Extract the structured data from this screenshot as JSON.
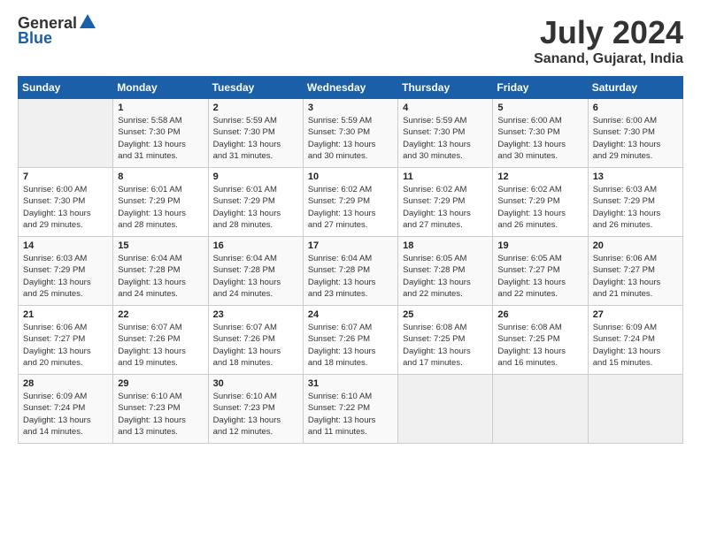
{
  "header": {
    "logo_general": "General",
    "logo_blue": "Blue",
    "title": "July 2024",
    "location": "Sanand, Gujarat, India"
  },
  "days_of_week": [
    "Sunday",
    "Monday",
    "Tuesday",
    "Wednesday",
    "Thursday",
    "Friday",
    "Saturday"
  ],
  "weeks": [
    [
      {
        "day": "",
        "info": ""
      },
      {
        "day": "1",
        "info": "Sunrise: 5:58 AM\nSunset: 7:30 PM\nDaylight: 13 hours\nand 31 minutes."
      },
      {
        "day": "2",
        "info": "Sunrise: 5:59 AM\nSunset: 7:30 PM\nDaylight: 13 hours\nand 31 minutes."
      },
      {
        "day": "3",
        "info": "Sunrise: 5:59 AM\nSunset: 7:30 PM\nDaylight: 13 hours\nand 30 minutes."
      },
      {
        "day": "4",
        "info": "Sunrise: 5:59 AM\nSunset: 7:30 PM\nDaylight: 13 hours\nand 30 minutes."
      },
      {
        "day": "5",
        "info": "Sunrise: 6:00 AM\nSunset: 7:30 PM\nDaylight: 13 hours\nand 30 minutes."
      },
      {
        "day": "6",
        "info": "Sunrise: 6:00 AM\nSunset: 7:30 PM\nDaylight: 13 hours\nand 29 minutes."
      }
    ],
    [
      {
        "day": "7",
        "info": "Sunrise: 6:00 AM\nSunset: 7:30 PM\nDaylight: 13 hours\nand 29 minutes."
      },
      {
        "day": "8",
        "info": "Sunrise: 6:01 AM\nSunset: 7:29 PM\nDaylight: 13 hours\nand 28 minutes."
      },
      {
        "day": "9",
        "info": "Sunrise: 6:01 AM\nSunset: 7:29 PM\nDaylight: 13 hours\nand 28 minutes."
      },
      {
        "day": "10",
        "info": "Sunrise: 6:02 AM\nSunset: 7:29 PM\nDaylight: 13 hours\nand 27 minutes."
      },
      {
        "day": "11",
        "info": "Sunrise: 6:02 AM\nSunset: 7:29 PM\nDaylight: 13 hours\nand 27 minutes."
      },
      {
        "day": "12",
        "info": "Sunrise: 6:02 AM\nSunset: 7:29 PM\nDaylight: 13 hours\nand 26 minutes."
      },
      {
        "day": "13",
        "info": "Sunrise: 6:03 AM\nSunset: 7:29 PM\nDaylight: 13 hours\nand 26 minutes."
      }
    ],
    [
      {
        "day": "14",
        "info": "Sunrise: 6:03 AM\nSunset: 7:29 PM\nDaylight: 13 hours\nand 25 minutes."
      },
      {
        "day": "15",
        "info": "Sunrise: 6:04 AM\nSunset: 7:28 PM\nDaylight: 13 hours\nand 24 minutes."
      },
      {
        "day": "16",
        "info": "Sunrise: 6:04 AM\nSunset: 7:28 PM\nDaylight: 13 hours\nand 24 minutes."
      },
      {
        "day": "17",
        "info": "Sunrise: 6:04 AM\nSunset: 7:28 PM\nDaylight: 13 hours\nand 23 minutes."
      },
      {
        "day": "18",
        "info": "Sunrise: 6:05 AM\nSunset: 7:28 PM\nDaylight: 13 hours\nand 22 minutes."
      },
      {
        "day": "19",
        "info": "Sunrise: 6:05 AM\nSunset: 7:27 PM\nDaylight: 13 hours\nand 22 minutes."
      },
      {
        "day": "20",
        "info": "Sunrise: 6:06 AM\nSunset: 7:27 PM\nDaylight: 13 hours\nand 21 minutes."
      }
    ],
    [
      {
        "day": "21",
        "info": "Sunrise: 6:06 AM\nSunset: 7:27 PM\nDaylight: 13 hours\nand 20 minutes."
      },
      {
        "day": "22",
        "info": "Sunrise: 6:07 AM\nSunset: 7:26 PM\nDaylight: 13 hours\nand 19 minutes."
      },
      {
        "day": "23",
        "info": "Sunrise: 6:07 AM\nSunset: 7:26 PM\nDaylight: 13 hours\nand 18 minutes."
      },
      {
        "day": "24",
        "info": "Sunrise: 6:07 AM\nSunset: 7:26 PM\nDaylight: 13 hours\nand 18 minutes."
      },
      {
        "day": "25",
        "info": "Sunrise: 6:08 AM\nSunset: 7:25 PM\nDaylight: 13 hours\nand 17 minutes."
      },
      {
        "day": "26",
        "info": "Sunrise: 6:08 AM\nSunset: 7:25 PM\nDaylight: 13 hours\nand 16 minutes."
      },
      {
        "day": "27",
        "info": "Sunrise: 6:09 AM\nSunset: 7:24 PM\nDaylight: 13 hours\nand 15 minutes."
      }
    ],
    [
      {
        "day": "28",
        "info": "Sunrise: 6:09 AM\nSunset: 7:24 PM\nDaylight: 13 hours\nand 14 minutes."
      },
      {
        "day": "29",
        "info": "Sunrise: 6:10 AM\nSunset: 7:23 PM\nDaylight: 13 hours\nand 13 minutes."
      },
      {
        "day": "30",
        "info": "Sunrise: 6:10 AM\nSunset: 7:23 PM\nDaylight: 13 hours\nand 12 minutes."
      },
      {
        "day": "31",
        "info": "Sunrise: 6:10 AM\nSunset: 7:22 PM\nDaylight: 13 hours\nand 11 minutes."
      },
      {
        "day": "",
        "info": ""
      },
      {
        "day": "",
        "info": ""
      },
      {
        "day": "",
        "info": ""
      }
    ]
  ]
}
